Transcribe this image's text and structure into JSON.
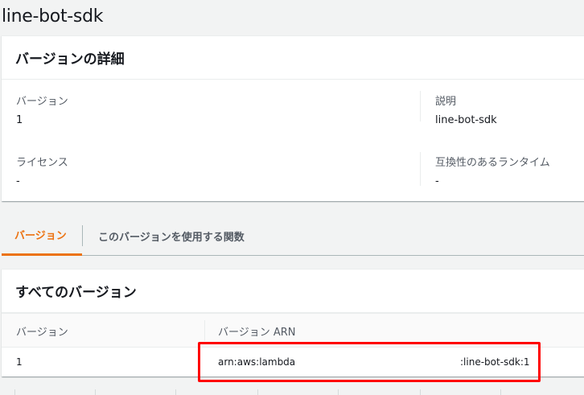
{
  "page": {
    "title": "line-bot-sdk"
  },
  "details": {
    "header": "バージョンの詳細",
    "version": {
      "label": "バージョン",
      "value": "1"
    },
    "description": {
      "label": "説明",
      "value": "line-bot-sdk"
    },
    "license": {
      "label": "ライセンス",
      "value": "-"
    },
    "runtimes": {
      "label": "互換性のあるランタイム",
      "value": "-"
    }
  },
  "tabs": [
    {
      "label": "バージョン",
      "active": true
    },
    {
      "label": "このバージョンを使用する関数",
      "active": false
    }
  ],
  "versions_table": {
    "header": "すべてのバージョン",
    "columns": [
      "バージョン",
      "バージョン ARN"
    ],
    "rows": [
      {
        "version": "1",
        "arn_prefix": "arn:aws:lambda",
        "arn_suffix": ":line-bot-sdk:1"
      }
    ]
  },
  "colors": {
    "accent": "#ec7211",
    "highlight_box": "#ff0000",
    "background": "#f2f3f3"
  }
}
